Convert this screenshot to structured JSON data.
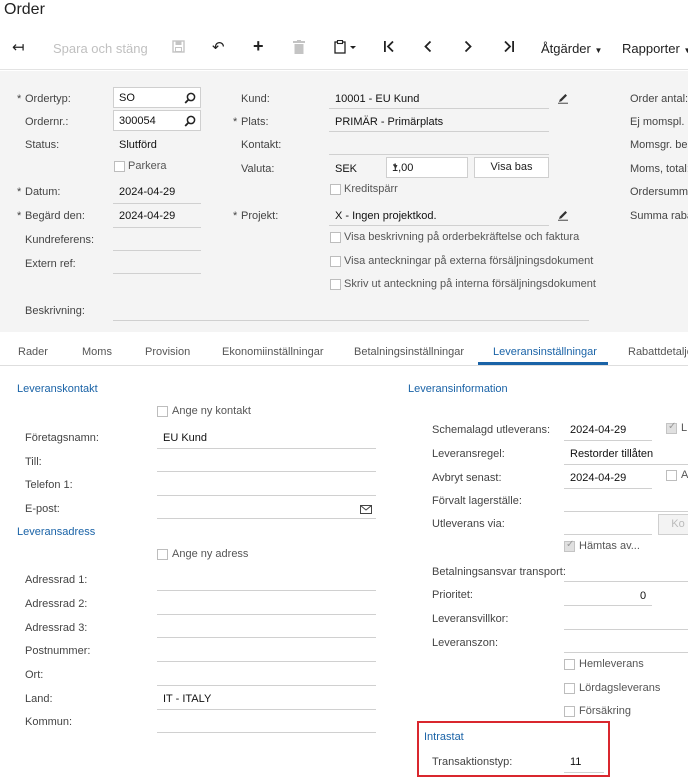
{
  "window": {
    "title": "Order"
  },
  "toolbar": {
    "back_icon": "arrow-left-icon",
    "save_close": "Spara och stäng",
    "save_icon": "save-icon",
    "undo_icon": "undo-icon",
    "add_icon": "plus-icon",
    "delete_icon": "trash-icon",
    "copy_icon": "clipboard-icon",
    "first_icon": "first-page-icon",
    "prev_icon": "chevron-left-icon",
    "next_icon": "chevron-right-icon",
    "last_icon": "last-page-icon",
    "actions": "Åtgärder",
    "reports": "Rapporter"
  },
  "header": {
    "order_type_label": "Ordertyp:",
    "order_type": "SO",
    "order_nr_label": "Ordernr.:",
    "order_nr": "300054",
    "status_label": "Status:",
    "status": "Slutförd",
    "park_label": "Parkera",
    "date_label": "Datum:",
    "date": "2024-04-29",
    "requested_label": "Begärd den:",
    "requested": "2024-04-29",
    "customer_ref_label": "Kundreferens:",
    "external_ref_label": "Extern ref:",
    "description_label": "Beskrivning:",
    "customer_label": "Kund:",
    "customer": "10001 - EU Kund",
    "location_label": "Plats:",
    "location": "PRIMÄR - Primärplats",
    "contact_label": "Kontakt:",
    "currency_label": "Valuta:",
    "currency": "SEK",
    "rate": "1,00",
    "show_base": "Visa bas",
    "credit_hold_label": "Kreditspärr",
    "project_label": "Projekt:",
    "project": "X - Ingen projektkod.",
    "show_desc_label": "Visa beskrivning på orderbekräftelse och faktura",
    "show_notes_label": "Visa anteckningar på externa försäljningsdokument",
    "print_notes_label": "Skriv ut anteckning på interna försäljningsdokument",
    "order_qty_label": "Order antal:",
    "vat_exempt_label": "Ej momspl. be",
    "vat_taxable_label": "Momsgr. bel",
    "vat_total_label": "Moms, total:",
    "order_total_label": "Ordersumma",
    "discount_total_label": "Summa raba"
  },
  "tabs": [
    {
      "label": "Rader"
    },
    {
      "label": "Moms"
    },
    {
      "label": "Provision"
    },
    {
      "label": "Ekonomiinställningar"
    },
    {
      "label": "Betalningsinställningar"
    },
    {
      "label": "Leveransinställningar"
    },
    {
      "label": "Rabattdetalje"
    }
  ],
  "delivery": {
    "contact_section": "Leveranskontakt",
    "add_contact_label": "Ange ny kontakt",
    "company_label": "Företagsnamn:",
    "company": "EU Kund",
    "to_label": "Till:",
    "phone_label": "Telefon 1:",
    "email_label": "E-post:",
    "address_section": "Leveransadress",
    "add_address_label": "Ange ny adress",
    "addr1_label": "Adressrad 1:",
    "addr2_label": "Adressrad 2:",
    "addr3_label": "Adressrad 3:",
    "postal_label": "Postnummer:",
    "city_label": "Ort:",
    "country_label": "Land:",
    "country": "IT - ITALY",
    "municipality_label": "Kommun:"
  },
  "delivery_info": {
    "section": "Leveransinformation",
    "scheduled_label": "Schemalagd utleverans:",
    "scheduled": "2024-04-29",
    "rule_label": "Leveransregel:",
    "rule": "Restorder tillåten",
    "cancel_label": "Avbryt senast:",
    "cancel": "2024-04-29",
    "warehouse_label": "Förvalt lagerställe:",
    "shipvia_label": "Utleverans via:",
    "shipvia_button": "Ko",
    "pickup_label": "Hämtas av...",
    "freight_label": "Betalningsansvar transport:",
    "priority_label": "Prioritet:",
    "priority": "0",
    "terms_label": "Leveransvillkor:",
    "zone_label": "Leveranszon:",
    "home_delivery_label": "Hemleverans",
    "saturday_label": "Lördagsleverans",
    "insurance_label": "Försäkring",
    "right_check1_label": "L",
    "right_check2_label": "A"
  },
  "intrastat": {
    "section": "Intrastat",
    "type_label": "Transaktionstyp:",
    "type": "11"
  }
}
